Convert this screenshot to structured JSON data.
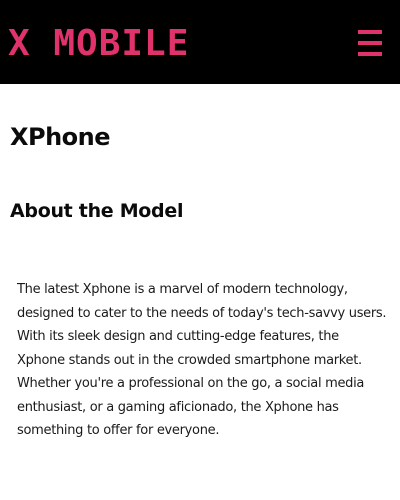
{
  "header": {
    "brand": "X MOBILE",
    "menu_icon": "hamburger-menu-icon",
    "background_color": "#000000",
    "accent_color": "#e0336b"
  },
  "main": {
    "title": "XPhone",
    "section_heading": "About the Model",
    "paragraph": "The latest Xphone is a marvel of modern technology, designed to cater to the needs of today's tech-savvy users. With its sleek design and cutting-edge features, the Xphone stands out in the crowded smartphone market. Whether you're a professional on the go, a social media enthusiast, or a gaming aficionado, the Xphone has something to offer for everyone."
  }
}
